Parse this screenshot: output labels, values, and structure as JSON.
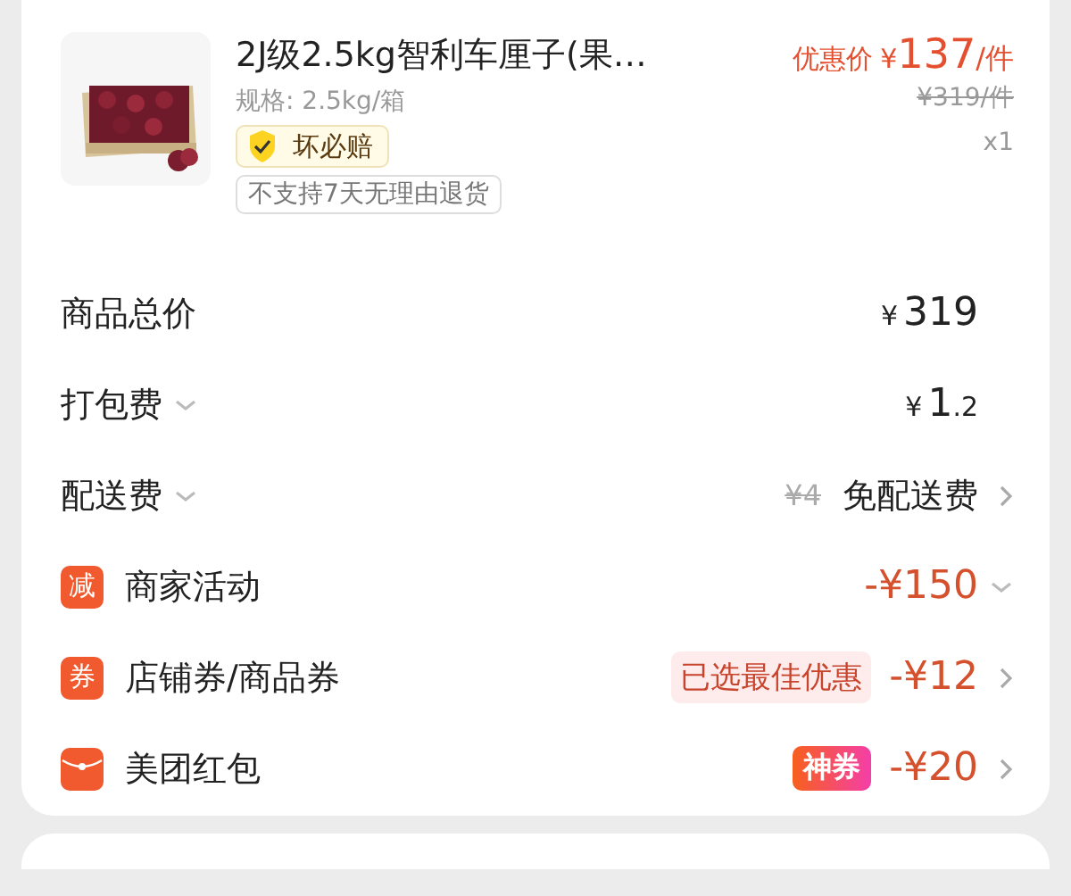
{
  "product": {
    "title": "2J级2.5kg智利车厘子(果…",
    "spec": "规格: 2.5kg/箱",
    "guarantee": "坏必赔",
    "return_policy": "不支持7天无理由退货",
    "promo_label": "优惠价",
    "currency": "¥",
    "price": "137",
    "unit": "/件",
    "original_price": "¥319/件",
    "quantity": "x1"
  },
  "fees": [
    {
      "label": "商品总价",
      "dropdown": false,
      "currency": "¥",
      "amount": "319",
      "arrow": false
    },
    {
      "label": "打包费",
      "dropdown": true,
      "currency": "¥",
      "amount": "1",
      "decimal": ".2",
      "arrow": false
    },
    {
      "label": "配送费",
      "dropdown": true,
      "struck": "¥4",
      "note": "免配送费",
      "arrow": true
    }
  ],
  "discounts": [
    {
      "kind": "text-icon",
      "icon_text": "减",
      "label": "商家活动",
      "amount": "-¥150",
      "expandable": true,
      "arrow": false
    },
    {
      "kind": "text-icon",
      "icon_text": "券",
      "label": "店铺券/商品券",
      "tag": "已选最佳优惠",
      "amount": "-¥12",
      "expandable": false,
      "arrow": true
    },
    {
      "kind": "envelope",
      "label": "美团红包",
      "badge": "神券",
      "amount": "-¥20",
      "expandable": false,
      "arrow": true
    }
  ]
}
